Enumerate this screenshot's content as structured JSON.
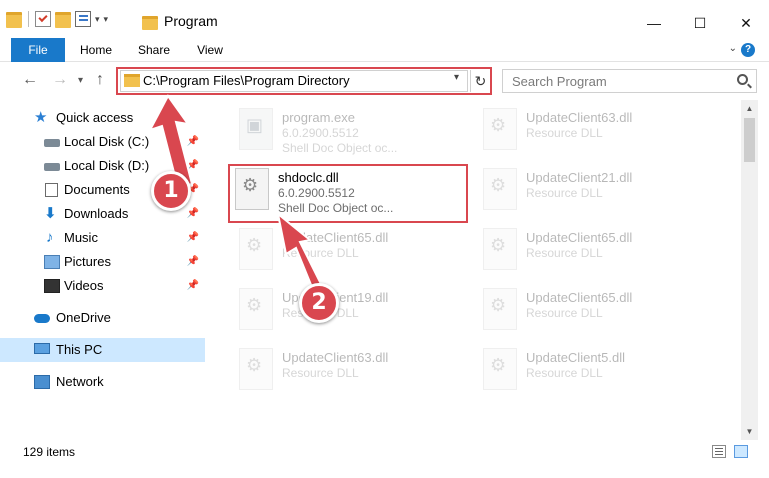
{
  "window": {
    "title": "Program",
    "minimize": "—",
    "maximize": "☐",
    "close": "✕"
  },
  "ribbon": {
    "tabs": [
      {
        "label": "File"
      },
      {
        "label": "Home"
      },
      {
        "label": "Share"
      },
      {
        "label": "View"
      }
    ],
    "help": "?"
  },
  "address": {
    "path": "C:\\Program Files\\Program Directory",
    "refresh": "↻"
  },
  "search": {
    "placeholder": "Search Program"
  },
  "sidebar": {
    "items": [
      {
        "label": "Quick access",
        "icon": "star-icon"
      },
      {
        "label": "Local Disk (C:)",
        "icon": "disk-icon",
        "pinned": true
      },
      {
        "label": "Local Disk (D:)",
        "icon": "disk-icon",
        "pinned": true
      },
      {
        "label": "Documents",
        "icon": "documents-icon",
        "pinned": true
      },
      {
        "label": "Downloads",
        "icon": "downloads-icon",
        "pinned": true
      },
      {
        "label": "Music",
        "icon": "music-icon",
        "pinned": true
      },
      {
        "label": "Pictures",
        "icon": "pictures-icon",
        "pinned": true
      },
      {
        "label": "Videos",
        "icon": "videos-icon",
        "pinned": true
      },
      {
        "label": "OneDrive",
        "icon": "onedrive-icon"
      },
      {
        "label": "This PC",
        "icon": "pc-icon",
        "selected": true
      },
      {
        "label": "Network",
        "icon": "network-icon"
      }
    ]
  },
  "files": [
    {
      "name": "program.exe",
      "line1": "6.0.2900.5512",
      "line2": "Shell Doc Object oc...",
      "faded": true
    },
    {
      "name": "UpdateClient63.dll",
      "line1": "Resource DLL",
      "line2": "",
      "faded": true
    },
    {
      "name": "shdoclc.dll",
      "line1": "6.0.2900.5512",
      "line2": "Shell Doc Object oc...",
      "faded": false
    },
    {
      "name": "UpdateClient21.dll",
      "line1": "Resource DLL",
      "line2": "",
      "faded": true
    },
    {
      "name": "UpdateClient65.dll",
      "line1": "Resource DLL",
      "line2": "",
      "faded": true
    },
    {
      "name": "UpdateClient65.dll",
      "line1": "Resource DLL",
      "line2": "",
      "faded": true
    },
    {
      "name": "UpdateClient19.dll",
      "line1": "Resource DLL",
      "line2": "",
      "faded": true
    },
    {
      "name": "UpdateClient65.dll",
      "line1": "Resource DLL",
      "line2": "",
      "faded": true
    },
    {
      "name": "UpdateClient63.dll",
      "line1": "Resource DLL",
      "line2": "",
      "faded": true
    },
    {
      "name": "UpdateClient5.dll",
      "line1": "Resource DLL",
      "line2": "",
      "faded": true
    }
  ],
  "status": {
    "count": "129 items"
  },
  "callouts": [
    {
      "number": "1"
    },
    {
      "number": "2"
    }
  ],
  "colors": {
    "accent": "#1979ca",
    "callout": "#d9474f",
    "selected": "#cde8ff"
  }
}
